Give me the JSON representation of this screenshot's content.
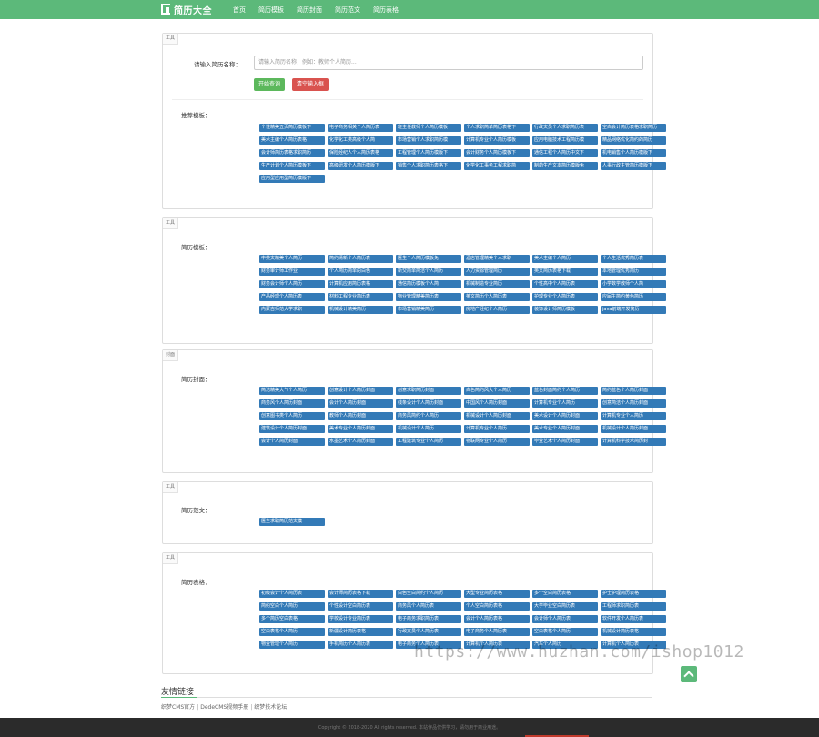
{
  "header": {
    "logo_text": "简历大全",
    "logo_sub": "RESUME",
    "nav": [
      "首页",
      "简历模板",
      "简历封面",
      "简历范文",
      "简历表格"
    ]
  },
  "search_panel": {
    "tag": "工具",
    "label": "请输入简历名称：",
    "placeholder": "请输入简历名称，例如：教师个人简历...",
    "search_button": "开始查询",
    "clear_button": "清空输入框",
    "recommend_label": "推荐模板：",
    "tags": [
      "个性精美五页简历模板下",
      "电子商务相关个人简历表",
      "班主任教师个人简历模板",
      "个人求职简单简历表格下",
      "行政文员个人求职简历表",
      "空白会计简历表格求职简历",
      "美术主编个人简历表格",
      "化学化工类高级个人简",
      "市场营销个人求职简历模",
      "计算机专业个人简历模板",
      "应用电脑技术工程简历模",
      "精品网络优化简约的简历",
      "会计师简历表格求职简历",
      "保险经纪人个人简历表格",
      "工程管理个人简历模版下",
      "会计财务个人简历模板下",
      "通信工程个人简历中文下",
      "机电销售个人简历模版下",
      "生产计划个人简历模板下",
      "高级研发个人简历模版下",
      "销售个人求职简历表格下",
      "化学化工事务工程求职简",
      "制药生产文本简历模版免",
      "人事行政主管简历模版下",
      "应用型应用型简历模版下"
    ]
  },
  "template_panel": {
    "tag": "工具",
    "label": "简历模板：",
    "tags": [
      "中英文精美个人简历",
      "简约清新个人简历表",
      "医生个人简历模板免",
      "酒店管理精美个人求职",
      "美术主编个人简历",
      "个人生活优秀简历表",
      "财务审计师工作业",
      "个人简历简单的白色",
      "新交简单简洁个人简历",
      "人力资源管理简历",
      "英文简历表格下载",
      "本地管理优秀简历",
      "财务会计师个人简历",
      "计算机应用简历表格",
      "通信简历模板个人简",
      "机械制造专业简历",
      "个性高中个人简历表",
      "小学数学教师个人简",
      "产品经理个人简历表",
      "材料工程专业简历表",
      "物业管理精美简历表",
      "英文简历个人简历表",
      "护理专业个人简历表",
      "应届生简约黄色简历",
      "内蒙古师范大学求职",
      "机械设计精美简历",
      "市场营销精美简历",
      "房地产经纪个人简历",
      "装饰设计师简历模板",
      "java前端开发简历"
    ]
  },
  "cover_panel": {
    "tag": "封面",
    "label": "简历封面：",
    "tags": [
      "简洁精美大气个人简历",
      "创意设计个人简历封面",
      "创意求职简历封面",
      "白色简约风大个人简历",
      "蓝色封面简约个人简历",
      "简约蓝色个人简历封面",
      "商务风个人简历封面",
      "会计个人简历封面",
      "线条设计个人简历封面",
      "中国风个人简历封面",
      "计算机专业个人简历",
      "创意简洁个人简历封面",
      "创意图书类个人简历",
      "教师个人简历封面",
      "商务风简约个人简历",
      "机械设计个人简历封面",
      "美术设计个人简历封面",
      "计算机专业个人简历",
      "建筑设计个人简历封面",
      "美术专业个人简历封面",
      "机械设计个人简历",
      "计算机专业个人简历",
      "美术专业个人简历封面",
      "机械设计个人简历封面",
      "会计个人简历封面",
      "水墨艺术个人简历封面",
      "工程建筑专业个人简历",
      "物联网专业个人简历",
      "毕业艺术个人简历封面",
      "计算机科学技术简历封"
    ]
  },
  "essay_panel": {
    "tag": "工具",
    "label": "简历范文：",
    "tags": [
      "医生求职简历范文模"
    ]
  },
  "table_panel": {
    "tag": "工具",
    "label": "简历表格：",
    "tags": [
      "初级会计个人简历表",
      "会计师简历表格下载",
      "白色空白简约个人简历",
      "大型专业简历表格",
      "多个空白简历表格",
      "护士护理简历表格",
      "简约空白个人简历",
      "个性设计空白简历表",
      "商务风个人简历表",
      "个人空白简历表格",
      "大学毕业空白简历表",
      "工程师求职简历表",
      "多个简历空白表格",
      "学校设计专业简历表",
      "电子商务求职简历表",
      "会计个人简历表格",
      "会计师个人简历表",
      "软件开发个人简历表",
      "空白表格个人简历",
      "新疆设计简历表格",
      "行政文员个人简历表",
      "电子商务个人简历表",
      "空白表格个人简历",
      "机械设计简历表格",
      "物业管理个人简历",
      "手机简历个人简历表",
      "电子商务个人简历表",
      "计算机个人简历表",
      "汽车个人简历",
      "计算机个人简历表"
    ]
  },
  "friend_links": {
    "title": "友情链接",
    "items": [
      "织梦CMS官方",
      "DedeCMS视频手册",
      "织梦技术论坛"
    ]
  },
  "footer": {
    "copyright": "Copyright © 2018-2020 All rights reserved. 本站作品仅供学习，请勿用于商业用途。"
  },
  "watermark": "https://www.huzhan.com/ishop1012"
}
